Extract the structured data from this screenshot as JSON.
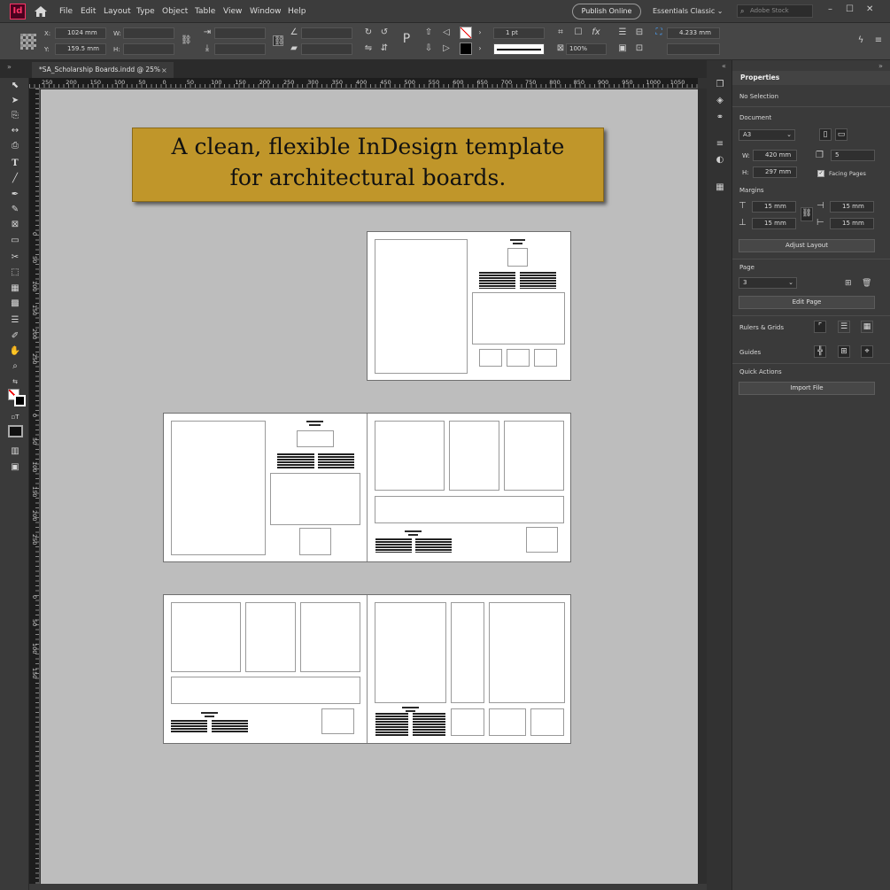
{
  "app": {
    "logo": "Id"
  },
  "menu": [
    "File",
    "Edit",
    "Layout",
    "Type",
    "Object",
    "Table",
    "View",
    "Window",
    "Help"
  ],
  "topbar": {
    "publish_label": "Publish Online",
    "workspace_label": "Essentials Classic",
    "stock_placeholder": "Adobe Stock"
  },
  "control": {
    "x_label": "X:",
    "x_value": "1024 mm",
    "y_label": "Y:",
    "y_value": "159.5 mm",
    "w_label": "W:",
    "h_label": "H:",
    "stroke_weight": "1 pt",
    "opacity": "100%",
    "stroke_offset": "4.233 mm"
  },
  "document": {
    "tab_title": "*SA_Scholarship Boards.indd @ 25%",
    "close_glyph": "×"
  },
  "banner": {
    "line1": "A clean, flexible InDesign template",
    "line2": "for architectural boards."
  },
  "ruler": {
    "h_ticks": [
      "250",
      "200",
      "150",
      "100",
      "50",
      "0",
      "50",
      "100",
      "150",
      "200",
      "250",
      "300",
      "350",
      "400",
      "450",
      "500",
      "550",
      "600",
      "650",
      "700",
      "750",
      "800",
      "850",
      "900",
      "950",
      "1000",
      "1050"
    ],
    "v_ticks": [
      "0",
      "50",
      "100",
      "150",
      "200",
      "250",
      "0",
      "50",
      "100",
      "150",
      "200",
      "250",
      "0",
      "50",
      "100",
      "150"
    ]
  },
  "properties": {
    "title": "Properties",
    "selection": "No Selection",
    "document_section": "Document",
    "page_size": "A3",
    "w_label": "W:",
    "width": "420 mm",
    "h_label": "H:",
    "height": "297 mm",
    "pages_count": "5",
    "facing_pages": "Facing Pages",
    "margins_section": "Margins",
    "margin_top": "15 mm",
    "margin_bottom": "15 mm",
    "margin_left": "15 mm",
    "margin_right": "15 mm",
    "adjust_layout": "Adjust Layout",
    "page_section": "Page",
    "page_number": "3",
    "edit_page": "Edit Page",
    "rulers_grids": "Rulers & Grids",
    "guides": "Guides",
    "quick_actions": "Quick Actions",
    "import_file": "Import File"
  },
  "icons": [
    "home-icon",
    "selection-tool-icon",
    "direct-selection-icon",
    "page-tool-icon",
    "gap-tool-icon",
    "content-collector-icon",
    "type-tool-icon",
    "line-tool-icon",
    "pen-tool-icon",
    "pencil-icon",
    "rectangle-frame-icon",
    "rectangle-icon",
    "scissors-icon",
    "free-transform-icon",
    "gradient-icon",
    "note-icon",
    "eyedropper-icon",
    "hand-icon",
    "zoom-icon"
  ],
  "colors": {
    "banner": "#c0962a",
    "pasteboard": "#bdbdbd",
    "accent": "#ff3366"
  }
}
